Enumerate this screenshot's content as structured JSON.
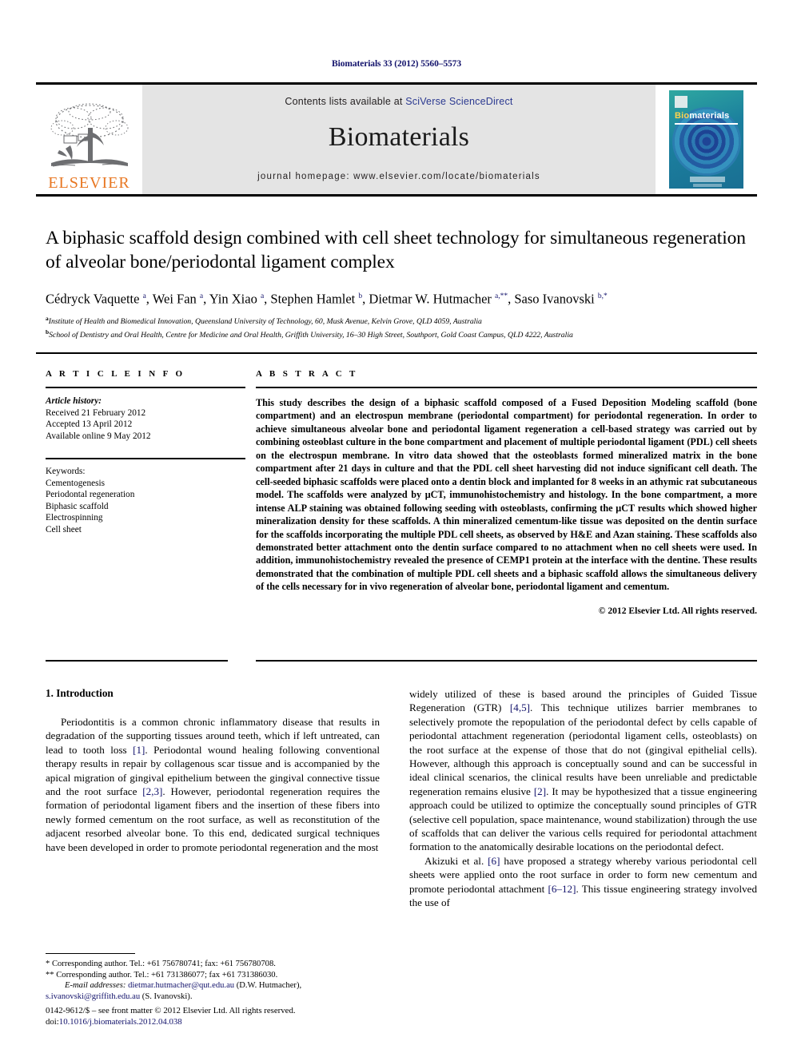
{
  "running_head": "Biomaterials 33 (2012) 5560–5573",
  "masthead": {
    "contents_prefix": "Contents lists available at ",
    "sciencedirect": "SciVerse ScienceDirect",
    "journal_name": "Biomaterials",
    "homepage": "journal homepage: www.elsevier.com/locate/biomaterials",
    "publisher_wordmark": "ELSEVIER",
    "cover": {
      "title_bio": "Bio",
      "title_rest": "materials"
    },
    "accent_orange": "#E87722",
    "link_blue": "#2b3990",
    "panel_gray": "#e4e4e4"
  },
  "article": {
    "title": "A biphasic scaffold design combined with cell sheet technology for simultaneous regeneration of alveolar bone/periodontal ligament complex",
    "authors_html": "Cédryck Vaquette <sup>a</sup>, Wei Fan <sup>a</sup>, Yin Xiao <sup>a</sup>, Stephen Hamlet <sup>b</sup>, Dietmar W. Hutmacher <sup>a,**</sup>, Saso Ivanovski <sup>b,*</sup>",
    "affiliations": [
      {
        "marker": "a",
        "text": "Institute of Health and Biomedical Innovation, Queensland University of Technology, 60, Musk Avenue, Kelvin Grove, QLD 4059, Australia"
      },
      {
        "marker": "b",
        "text": "School of Dentistry and Oral Health, Centre for Medicine and Oral Health, Griffith University, 16–30 High Street, Southport, Gold Coast Campus, QLD 4222, Australia"
      }
    ]
  },
  "article_info": {
    "heading": "A R T I C L E  I N F O",
    "history_label": "Article history:",
    "history": [
      "Received 21 February 2012",
      "Accepted 13 April 2012",
      "Available online 9 May 2012"
    ],
    "keywords_label": "Keywords:",
    "keywords": [
      "Cementogenesis",
      "Periodontal regeneration",
      "Biphasic scaffold",
      "Electrospinning",
      "Cell sheet"
    ]
  },
  "abstract": {
    "heading": "A B S T R A C T",
    "text": "This study describes the design of a biphasic scaffold composed of a Fused Deposition Modeling scaffold (bone compartment) and an electrospun membrane (periodontal compartment) for periodontal regeneration. In order to achieve simultaneous alveolar bone and periodontal ligament regeneration a cell-based strategy was carried out by combining osteoblast culture in the bone compartment and placement of multiple periodontal ligament (PDL) cell sheets on the electrospun membrane. In vitro data showed that the osteoblasts formed mineralized matrix in the bone compartment after 21 days in culture and that the PDL cell sheet harvesting did not induce significant cell death. The cell-seeded biphasic scaffolds were placed onto a dentin block and implanted for 8 weeks in an athymic rat subcutaneous model. The scaffolds were analyzed by μCT, immunohistochemistry and histology. In the bone compartment, a more intense ALP staining was obtained following seeding with osteoblasts, confirming the μCT results which showed higher mineralization density for these scaffolds. A thin mineralized cementum-like tissue was deposited on the dentin surface for the scaffolds incorporating the multiple PDL cell sheets, as observed by H&E and Azan staining. These scaffolds also demonstrated better attachment onto the dentin surface compared to no attachment when no cell sheets were used. In addition, immunohistochemistry revealed the presence of CEMP1 protein at the interface with the dentine. These results demonstrated that the combination of multiple PDL cell sheets and a biphasic scaffold allows the simultaneous delivery of the cells necessary for in vivo regeneration of alveolar bone, periodontal ligament and cementum.",
    "copyright": "© 2012 Elsevier Ltd. All rights reserved."
  },
  "introduction": {
    "heading": "1. Introduction",
    "left_paragraph_1_a": "Periodontitis is a common chronic inflammatory disease that results in degradation of the supporting tissues around teeth, which if left untreated, can lead to tooth loss ",
    "left_ref_1": "[1]",
    "left_paragraph_1_b": ". Periodontal wound healing following conventional therapy results in repair by collagenous scar tissue and is accompanied by the apical migration of gingival epithelium between the gingival connective tissue and the root surface ",
    "left_ref_2": "[2,3]",
    "left_paragraph_1_c": ". However, periodontal regeneration requires the formation of periodontal ligament fibers and the insertion of these fibers into newly formed cementum on the root surface, as well as reconstitution of the adjacent resorbed alveolar bone. To this end, dedicated surgical techniques have been developed in order to promote periodontal regeneration and the most",
    "right_paragraph_1_a": "widely utilized of these is based around the principles of Guided Tissue Regeneration (GTR) ",
    "right_ref_1": "[4,5]",
    "right_paragraph_1_b": ". This technique utilizes barrier membranes to selectively promote the repopulation of the periodontal defect by cells capable of periodontal attachment regeneration (periodontal ligament cells, osteoblasts) on the root surface at the expense of those that do not (gingival epithelial cells). However, although this approach is conceptually sound and can be successful in ideal clinical scenarios, the clinical results have been unreliable and predictable regeneration remains elusive ",
    "right_ref_2": "[2]",
    "right_paragraph_1_c": ". It may be hypothesized that a tissue engineering approach could be utilized to optimize the conceptually sound principles of GTR (selective cell population, space maintenance, wound stabilization) through the use of scaffolds that can deliver the various cells required for periodontal attachment formation to the anatomically desirable locations on the periodontal defect.",
    "right_paragraph_2_a": "Akizuki et al. ",
    "right_ref_3": "[6]",
    "right_paragraph_2_b": " have proposed a strategy whereby various periodontal cell sheets were applied onto the root surface in order to form new cementum and promote periodontal attachment ",
    "right_ref_4": "[6–12]",
    "right_paragraph_2_c": ". This tissue engineering strategy involved the use of"
  },
  "footnotes": {
    "corr_1": "* Corresponding author. Tel.: +61 756780741; fax: +61 756780708.",
    "corr_2": "** Corresponding author. Tel.: +61 731386077; fax +61 731386030.",
    "email_label": "E-mail addresses:",
    "email_1": "dietmar.hutmacher@qut.edu.au",
    "email_1_name": "(D.W. Hutmacher),",
    "email_2": "s.ivanovski@griffith.edu.au",
    "email_2_name": "(S. Ivanovski)."
  },
  "imprint": {
    "line1": "0142-9612/$ – see front matter © 2012 Elsevier Ltd. All rights reserved.",
    "doi_label": "doi:",
    "doi_value": "10.1016/j.biomaterials.2012.04.038"
  }
}
